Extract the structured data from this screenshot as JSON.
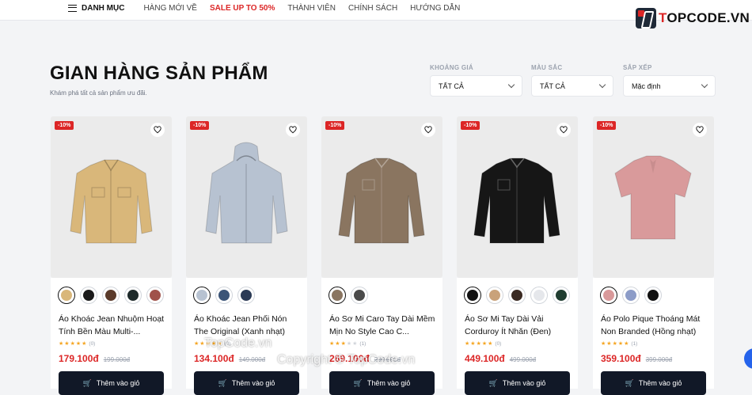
{
  "nav": {
    "menu_label": "DANH MỤC",
    "items": [
      "HÀNG MỚI VỀ",
      "SALE UP TO 50%",
      "THÀNH VIÊN",
      "CHÍNH SÁCH",
      "HƯỚNG DẪN"
    ]
  },
  "logo": {
    "prefix": "T",
    "rest": "OPCODE.VN"
  },
  "page": {
    "title": "GIAN HÀNG SẢN PHẨM",
    "subtitle": "Khám phá tất cả sản phẩm ưu đãi."
  },
  "filters": [
    {
      "label": "KHOẢNG GIÁ",
      "value": "TẤT CẢ"
    },
    {
      "label": "MÀU SẮC",
      "value": "TẤT CẢ"
    },
    {
      "label": "SẮP XẾP",
      "value": "Mặc định"
    }
  ],
  "products": [
    {
      "badge": "-10%",
      "name": "Áo Khoác Jean Nhuộm Hoạt Tính Bền Màu Multi-...",
      "rating": 5,
      "reviews": "(0)",
      "price": "179.100đ",
      "old_price": "199.000đ",
      "swatches": [
        "#d9b77a",
        "#1a1a1a",
        "#5a3a2a",
        "#1e2a2a",
        "#a0524a"
      ],
      "garment": "jacket",
      "color": "#d9b77a"
    },
    {
      "badge": "-10%",
      "name": "Áo Khoác Jean Phối Nón The Original (Xanh nhạt)",
      "rating": 5,
      "reviews": "(0)",
      "price": "134.100đ",
      "old_price": "149.000đ",
      "swatches": [
        "#b7c2d1",
        "#3c5577",
        "#2b3a55"
      ],
      "garment": "hoodie",
      "color": "#b7c2d1"
    },
    {
      "badge": "-10%",
      "name": "Áo Sơ Mi Caro Tay Dài Mềm Mịn No Style Cao C...",
      "rating": 3,
      "reviews": "(1)",
      "price": "269.100đ",
      "old_price": "299.000đ",
      "swatches": [
        "#8a7560",
        "#4a4a4a"
      ],
      "garment": "shirt",
      "color": "#8a7560"
    },
    {
      "badge": "-10%",
      "name": "Áo Sơ Mi Tay Dài Vải Corduroy Ít Nhăn (Đen)",
      "rating": 5,
      "reviews": "(0)",
      "price": "449.100đ",
      "old_price": "499.000đ",
      "swatches": [
        "#111111",
        "#c9a27a",
        "#3a2a22",
        "#e5e7eb",
        "#1f3d30"
      ],
      "garment": "shirt",
      "color": "#161616"
    },
    {
      "badge": "-10%",
      "name": "Áo Polo Pique Thoáng Mát Non Branded (Hồng nhạt)",
      "rating": 5,
      "reviews": "(1)",
      "price": "359.100đ",
      "old_price": "399.000đ",
      "swatches": [
        "#d9999a",
        "#8c9cc8",
        "#111111"
      ],
      "garment": "polo",
      "color": "#d99a9b"
    }
  ],
  "add_to_cart_label": "Thêm vào giỏ",
  "watermarks": [
    "TopCode.vn",
    "Copyright © TopCode.vn"
  ]
}
